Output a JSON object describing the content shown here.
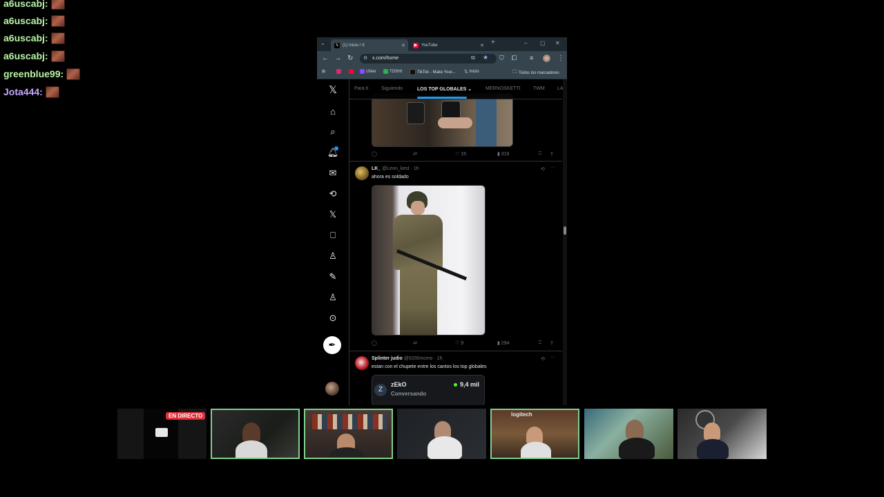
{
  "chat": [
    {
      "user": "a6uscabj:",
      "color": "#b9f5a6"
    },
    {
      "user": "a6uscabj:",
      "color": "#b9f5a6"
    },
    {
      "user": "a6uscabj:",
      "color": "#b9f5a6"
    },
    {
      "user": "a6uscabj:",
      "color": "#b9f5a6"
    },
    {
      "user": "greenblue99:",
      "color": "#b9f5a6"
    },
    {
      "user": "Jota444:",
      "color": "#c8a8ff"
    }
  ],
  "browser": {
    "tabs": [
      {
        "title": "(1) Inicio / X",
        "active": true
      },
      {
        "title": "YouTube",
        "active": false
      }
    ],
    "url": "x.com/home",
    "bookmarks": [
      "c0ker",
      "TOSHI",
      "TikTok - Make Your...",
      "Inicio"
    ],
    "all_bookmarks": "Todos los marcadores"
  },
  "x": {
    "tabs": [
      "Para ti",
      "Siguiendo",
      "LOS TOP GLOBALES",
      "MERNOSKETTI",
      "TWM",
      "LA"
    ],
    "selected_tab": "LOS TOP GLOBALES",
    "nav_icons": [
      "x-logo-icon",
      "home-icon",
      "search-icon",
      "notifications-icon",
      "messages-icon",
      "grok-icon",
      "x-premium-icon",
      "bookmarks-icon",
      "communities-icon",
      "compose-icon",
      "profile-icon",
      "more-icon"
    ],
    "posts": [
      {
        "likes": "15",
        "views": "316"
      },
      {
        "name": "LK_",
        "handle": "@Leon_kest",
        "time": "· 1h",
        "text": "ahora es soldado",
        "likes": "9",
        "views": "294"
      },
      {
        "name": "Splinter judio",
        "handle": "@0200mcmo",
        "time": "· 1h",
        "text": "estan con el chupete entre los cantos los top globales",
        "card": {
          "title": "zEkO",
          "subtitle": "Conversando",
          "listeners": "9,4 mil"
        }
      }
    ]
  },
  "stream": {
    "live_label": "EN DIRECTO"
  }
}
